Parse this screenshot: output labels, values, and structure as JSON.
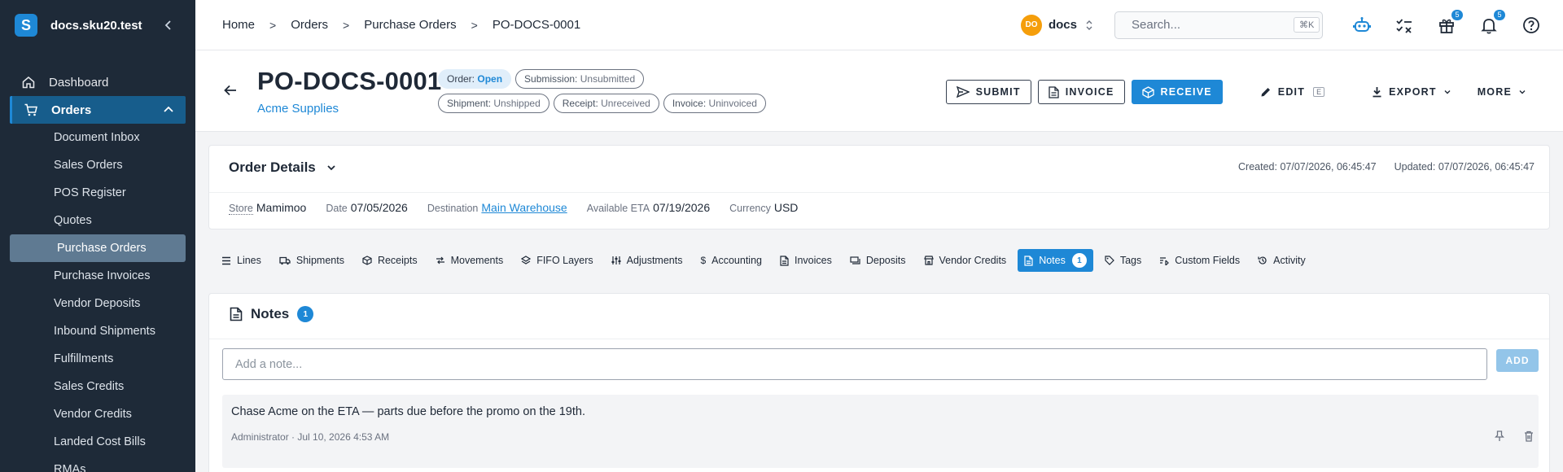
{
  "sidebar": {
    "brand": "docs.sku20.test",
    "logo_letter": "S",
    "dashboard": "Dashboard",
    "orders": "Orders",
    "items": [
      "Document Inbox",
      "Sales Orders",
      "POS Register",
      "Quotes",
      "Purchase Orders",
      "Purchase Invoices",
      "Vendor Deposits",
      "Inbound Shipments",
      "Fulfillments",
      "Sales Credits",
      "Vendor Credits",
      "Landed Cost Bills",
      "RMAs"
    ],
    "active_item": "Purchase Orders"
  },
  "topbar": {
    "breadcrumb": [
      "Home",
      "Orders",
      "Purchase Orders",
      "PO-DOCS-0001"
    ],
    "org_initials": "DO",
    "org_name": "docs",
    "search_placeholder": "Search...",
    "search_shortcut": "⌘K",
    "gift_badge": "5",
    "bell_badge": "5"
  },
  "header": {
    "title": "PO-DOCS-0001",
    "vendor": "Acme Supplies",
    "chips": [
      {
        "label": "Order:",
        "value": "Open"
      },
      {
        "label": "Submission:",
        "value": "Unsubmitted"
      },
      {
        "label": "Shipment:",
        "value": "Unshipped"
      },
      {
        "label": "Receipt:",
        "value": "Unreceived"
      },
      {
        "label": "Invoice:",
        "value": "Uninvoiced"
      }
    ],
    "actions": {
      "submit": "SUBMIT",
      "invoice": "INVOICE",
      "receive": "RECEIVE",
      "edit": "EDIT",
      "edit_shortcut": "E",
      "export": "EXPORT",
      "more": "MORE"
    }
  },
  "details": {
    "title": "Order Details",
    "created": "Created: 07/07/2026, 06:45:47",
    "updated": "Updated: 07/07/2026, 06:45:47",
    "fields": {
      "store_label": "Store",
      "store": "Mamimoo",
      "date_label": "Date",
      "date": "07/05/2026",
      "destination_label": "Destination",
      "destination": "Main Warehouse",
      "eta_label": "Available ETA",
      "eta": "07/19/2026",
      "currency_label": "Currency",
      "currency": "USD"
    }
  },
  "tabs": [
    "Lines",
    "Shipments",
    "Receipts",
    "Movements",
    "FIFO Layers",
    "Adjustments",
    "Accounting",
    "Invoices",
    "Deposits",
    "Vendor Credits",
    "Notes",
    "Tags",
    "Custom Fields",
    "Activity"
  ],
  "notes_tab_count": "1",
  "notes": {
    "title": "Notes",
    "count": "1",
    "placeholder": "Add a note...",
    "add_label": "ADD",
    "items": [
      {
        "text": "Chase Acme on the ETA — parts due before the promo on the 19th.",
        "meta": "Administrator · Jul 10, 2026 4:53 AM"
      }
    ]
  },
  "colors": {
    "accent": "#1e88d6",
    "sidebar_bg": "#1e2a38",
    "sidebar_active": "#175d8c",
    "org_avatar": "#f59e0b"
  }
}
